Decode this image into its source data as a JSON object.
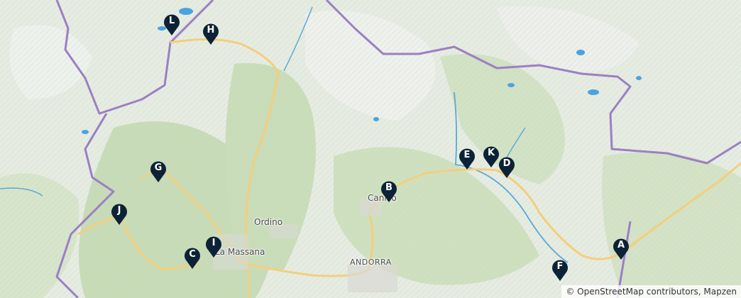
{
  "places": {
    "ordino": "Ordino",
    "canillo": "Canillo",
    "la_massana": "La Massana",
    "andorra": "ANDORRA"
  },
  "markers": [
    "A",
    "B",
    "C",
    "D",
    "E",
    "F",
    "G",
    "H",
    "I",
    "J",
    "K",
    "L"
  ],
  "attribution": "© OpenStreetMap contributors, Mapzen",
  "colors": {
    "border": "#9b7fc4",
    "road": "#f3cf7c",
    "river": "#5aa9d6",
    "lake": "#4aa3df",
    "marker": "#0c2236"
  }
}
